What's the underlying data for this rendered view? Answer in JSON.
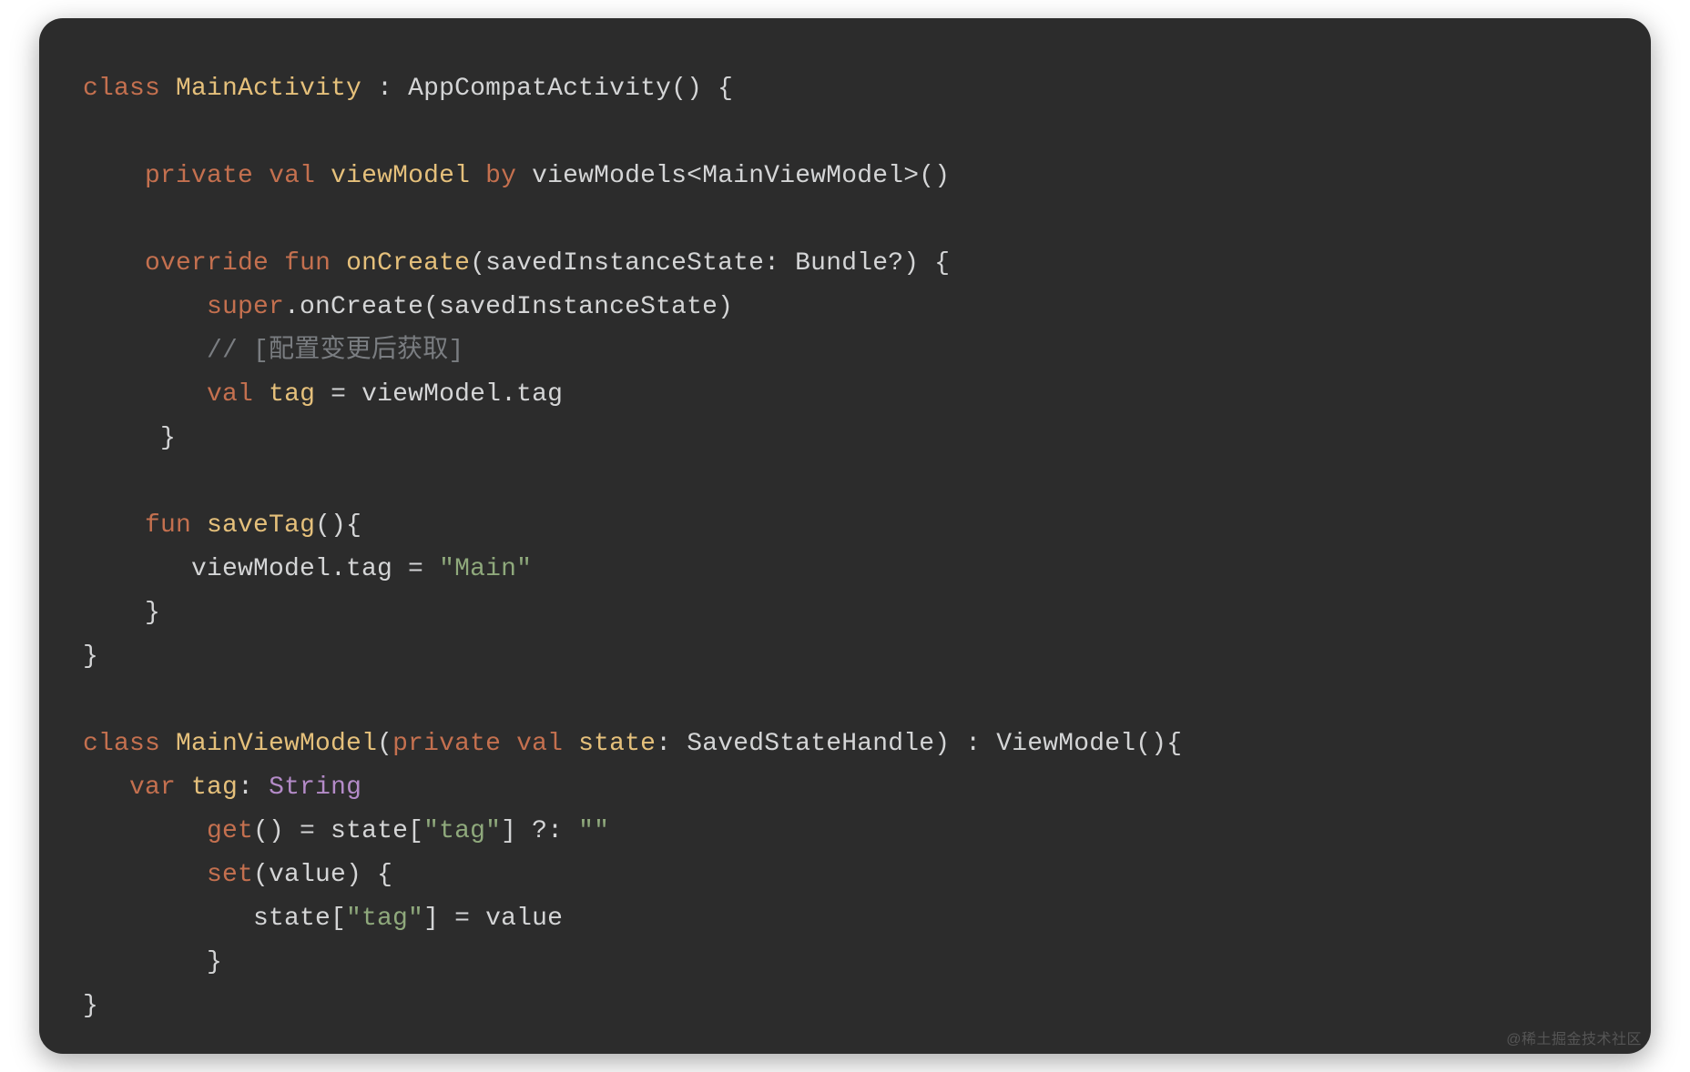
{
  "code": {
    "lines": [
      [
        {
          "cls": "tok-kw",
          "t": "class"
        },
        {
          "cls": "tok-plain",
          "t": " "
        },
        {
          "cls": "tok-name",
          "t": "MainActivity"
        },
        {
          "cls": "tok-plain",
          "t": " : AppCompatActivity() {"
        }
      ],
      [],
      [
        {
          "cls": "tok-plain",
          "t": "    "
        },
        {
          "cls": "tok-kw",
          "t": "private"
        },
        {
          "cls": "tok-plain",
          "t": " "
        },
        {
          "cls": "tok-kw",
          "t": "val"
        },
        {
          "cls": "tok-plain",
          "t": " "
        },
        {
          "cls": "tok-name",
          "t": "viewModel"
        },
        {
          "cls": "tok-plain",
          "t": " "
        },
        {
          "cls": "tok-kw",
          "t": "by"
        },
        {
          "cls": "tok-plain",
          "t": " viewModels<MainViewModel>()"
        }
      ],
      [],
      [
        {
          "cls": "tok-plain",
          "t": "    "
        },
        {
          "cls": "tok-kw",
          "t": "override"
        },
        {
          "cls": "tok-plain",
          "t": " "
        },
        {
          "cls": "tok-kw",
          "t": "fun"
        },
        {
          "cls": "tok-plain",
          "t": " "
        },
        {
          "cls": "tok-name",
          "t": "onCreate"
        },
        {
          "cls": "tok-plain",
          "t": "(savedInstanceState: Bundle?) {"
        }
      ],
      [
        {
          "cls": "tok-plain",
          "t": "        "
        },
        {
          "cls": "tok-kw",
          "t": "super"
        },
        {
          "cls": "tok-plain",
          "t": ".onCreate(savedInstanceState)"
        }
      ],
      [
        {
          "cls": "tok-plain",
          "t": "        "
        },
        {
          "cls": "tok-comm",
          "t": "// [配置变更后获取]"
        }
      ],
      [
        {
          "cls": "tok-plain",
          "t": "        "
        },
        {
          "cls": "tok-kw",
          "t": "val"
        },
        {
          "cls": "tok-plain",
          "t": " "
        },
        {
          "cls": "tok-name",
          "t": "tag"
        },
        {
          "cls": "tok-plain",
          "t": " = viewModel.tag"
        }
      ],
      [
        {
          "cls": "tok-plain",
          "t": "     }"
        }
      ],
      [],
      [
        {
          "cls": "tok-plain",
          "t": "    "
        },
        {
          "cls": "tok-kw",
          "t": "fun"
        },
        {
          "cls": "tok-plain",
          "t": " "
        },
        {
          "cls": "tok-name",
          "t": "saveTag"
        },
        {
          "cls": "tok-plain",
          "t": "(){"
        }
      ],
      [
        {
          "cls": "tok-plain",
          "t": "       viewModel.tag = "
        },
        {
          "cls": "tok-str",
          "t": "\"Main\""
        }
      ],
      [
        {
          "cls": "tok-plain",
          "t": "    }"
        }
      ],
      [
        {
          "cls": "tok-plain",
          "t": "}"
        }
      ],
      [],
      [
        {
          "cls": "tok-kw",
          "t": "class"
        },
        {
          "cls": "tok-plain",
          "t": " "
        },
        {
          "cls": "tok-name",
          "t": "MainViewModel"
        },
        {
          "cls": "tok-plain",
          "t": "("
        },
        {
          "cls": "tok-kw",
          "t": "private"
        },
        {
          "cls": "tok-plain",
          "t": " "
        },
        {
          "cls": "tok-kw",
          "t": "val"
        },
        {
          "cls": "tok-plain",
          "t": " "
        },
        {
          "cls": "tok-name",
          "t": "state"
        },
        {
          "cls": "tok-plain",
          "t": ": SavedStateHandle) : ViewModel(){"
        }
      ],
      [
        {
          "cls": "tok-plain",
          "t": "   "
        },
        {
          "cls": "tok-kw",
          "t": "var"
        },
        {
          "cls": "tok-plain",
          "t": " "
        },
        {
          "cls": "tok-name",
          "t": "tag"
        },
        {
          "cls": "tok-plain",
          "t": ": "
        },
        {
          "cls": "tok-type",
          "t": "String"
        }
      ],
      [
        {
          "cls": "tok-plain",
          "t": "        "
        },
        {
          "cls": "tok-kw",
          "t": "get"
        },
        {
          "cls": "tok-plain",
          "t": "() = state["
        },
        {
          "cls": "tok-str",
          "t": "\"tag\""
        },
        {
          "cls": "tok-plain",
          "t": "] ?: "
        },
        {
          "cls": "tok-str",
          "t": "\"\""
        }
      ],
      [
        {
          "cls": "tok-plain",
          "t": "        "
        },
        {
          "cls": "tok-kw",
          "t": "set"
        },
        {
          "cls": "tok-plain",
          "t": "(value) {"
        }
      ],
      [
        {
          "cls": "tok-plain",
          "t": "           state["
        },
        {
          "cls": "tok-str",
          "t": "\"tag\""
        },
        {
          "cls": "tok-plain",
          "t": "] = value"
        }
      ],
      [
        {
          "cls": "tok-plain",
          "t": "        }"
        }
      ],
      [
        {
          "cls": "tok-plain",
          "t": "}"
        }
      ]
    ]
  },
  "watermark": "@稀土掘金技术社区"
}
